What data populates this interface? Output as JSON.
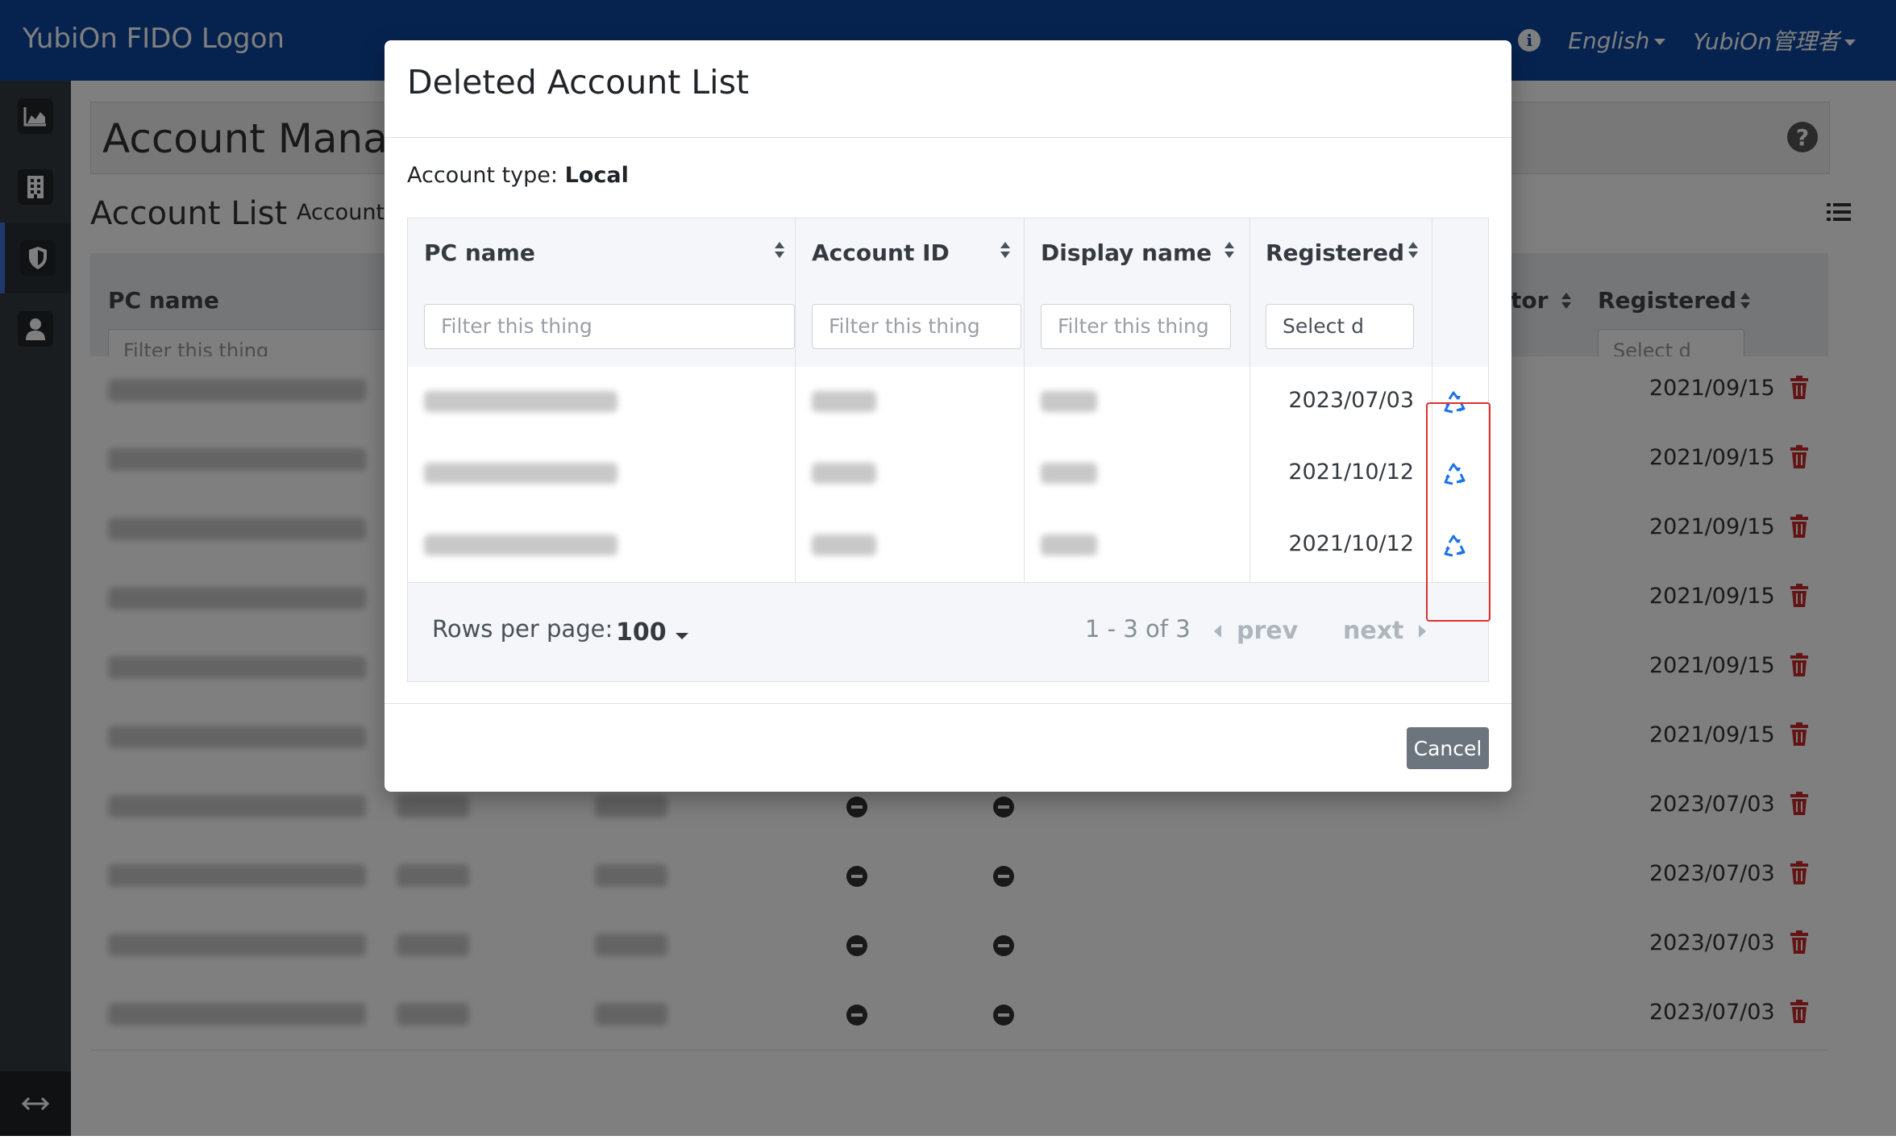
{
  "navbar": {
    "brand": "YubiOn FIDO Logon",
    "language": "English",
    "user": "YubiOn管理者",
    "icons": [
      "info-icon",
      "chevron-down-icon"
    ]
  },
  "sidebar": {
    "items": [
      {
        "icon": "chart-area-icon"
      },
      {
        "icon": "building-icon"
      },
      {
        "icon": "shield-icon",
        "active": true
      },
      {
        "icon": "user-icon"
      }
    ],
    "toggle_icon": "arrows-horizontal-icon"
  },
  "page": {
    "title": "Account Manage",
    "section_title": "Account List",
    "section_sub": "Account",
    "columns": {
      "pc_name": "PC name",
      "operator_partial": "tor",
      "registered": "Registered"
    },
    "filter_placeholder": "Filter this thing",
    "date_placeholder": "Select d",
    "rows": [
      {
        "date": "2021/09/15",
        "minus": false
      },
      {
        "date": "2021/09/15",
        "minus": false
      },
      {
        "date": "2021/09/15",
        "minus": false
      },
      {
        "date": "2021/09/15",
        "minus": false
      },
      {
        "date": "2021/09/15",
        "minus": false
      },
      {
        "date": "2021/09/15",
        "minus": true
      },
      {
        "date": "2023/07/03",
        "minus": true
      },
      {
        "date": "2023/07/03",
        "minus": true
      },
      {
        "date": "2023/07/03",
        "minus": true
      },
      {
        "date": "2023/07/03",
        "minus": true
      }
    ]
  },
  "modal": {
    "title": "Deleted Account List",
    "account_type_label": "Account type:",
    "account_type_value": "Local",
    "columns": {
      "pc_name": "PC name",
      "account_id": "Account ID",
      "display_name": "Display name",
      "registered": "Registered"
    },
    "filters": {
      "pc_name": "Filter this thing",
      "account_id": "Filter this thing",
      "display_name": "Filter this thing",
      "registered": "Select d"
    },
    "rows": [
      {
        "registered": "2023/07/03"
      },
      {
        "registered": "2021/10/12"
      },
      {
        "registered": "2021/10/12"
      }
    ],
    "pager": {
      "rows_per_page_label": "Rows per page:",
      "rows_per_page_value": "100",
      "range": "1 - 3 of 3",
      "prev": "prev",
      "next": "next"
    },
    "cancel_label": "Cancel",
    "colors": {
      "recycle": "#1a73e8",
      "highlight": "#e0302e",
      "navbar": "#0d47a1",
      "cancel": "#6c757d",
      "trash": "#c62828"
    }
  }
}
